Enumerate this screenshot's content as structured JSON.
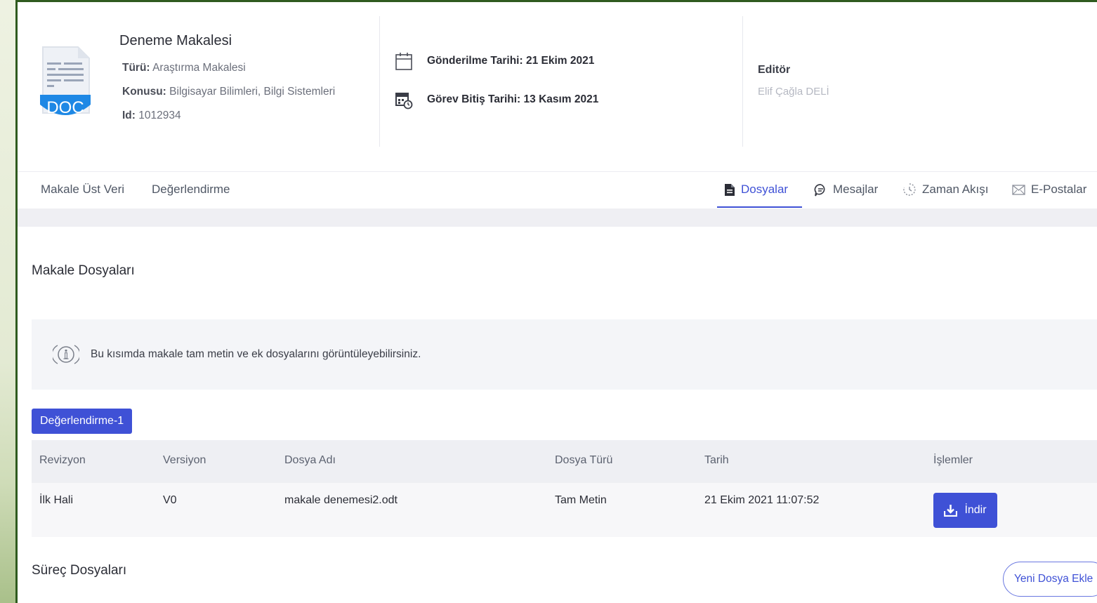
{
  "article": {
    "title": "Deneme Makalesi",
    "icon_text": "DOC",
    "type_label": "Türü:",
    "type_value": "Araştırma Makalesi",
    "subject_label": "Konusu:",
    "subject_value": "Bilgisayar Bilimleri, Bilgi Sistemleri",
    "id_label": "Id:",
    "id_value": "1012934"
  },
  "dates": {
    "submitted": "Gönderilme Tarihi: 21 Ekim 2021",
    "due": "Görev Bitiş Tarihi: 13 Kasım 2021"
  },
  "editor": {
    "label": "Editör",
    "name": "Elif Çağla DELİ"
  },
  "tabs": {
    "left": [
      {
        "label": "Makale Üst Veri"
      },
      {
        "label": "Değerlendirme"
      }
    ],
    "right": [
      {
        "label": "Dosyalar",
        "icon": "file-icon",
        "active": true
      },
      {
        "label": "Mesajlar",
        "icon": "chat-icon"
      },
      {
        "label": "Zaman Akışı",
        "icon": "timeline-icon"
      },
      {
        "label": "E-Postalar",
        "icon": "mail-icon"
      }
    ]
  },
  "files_section": {
    "title": "Makale Dosyaları",
    "info": "Bu kısımda makale tam metin ve ek dosyalarını görüntüleyebilirsiniz.",
    "evaluation_tag": "Değerlendirme-1",
    "columns": [
      "Revizyon",
      "Versiyon",
      "Dosya Adı",
      "Dosya Türü",
      "Tarih",
      "İşlemler"
    ],
    "rows": [
      {
        "revision": "İlk Hali",
        "version": "V0",
        "file_name": "makale denemesi2.odt",
        "file_type": "Tam Metin",
        "date": "21 Ekim 2021 11:07:52",
        "action": "İndir"
      }
    ]
  },
  "process_section": {
    "title": "Süreç Dosyaları",
    "add_button": "Yeni Dosya Ekle"
  },
  "colors": {
    "accent": "#3f51d6",
    "frame_border": "#2f5b1f",
    "doc_icon_blue": "#1e88e5"
  }
}
